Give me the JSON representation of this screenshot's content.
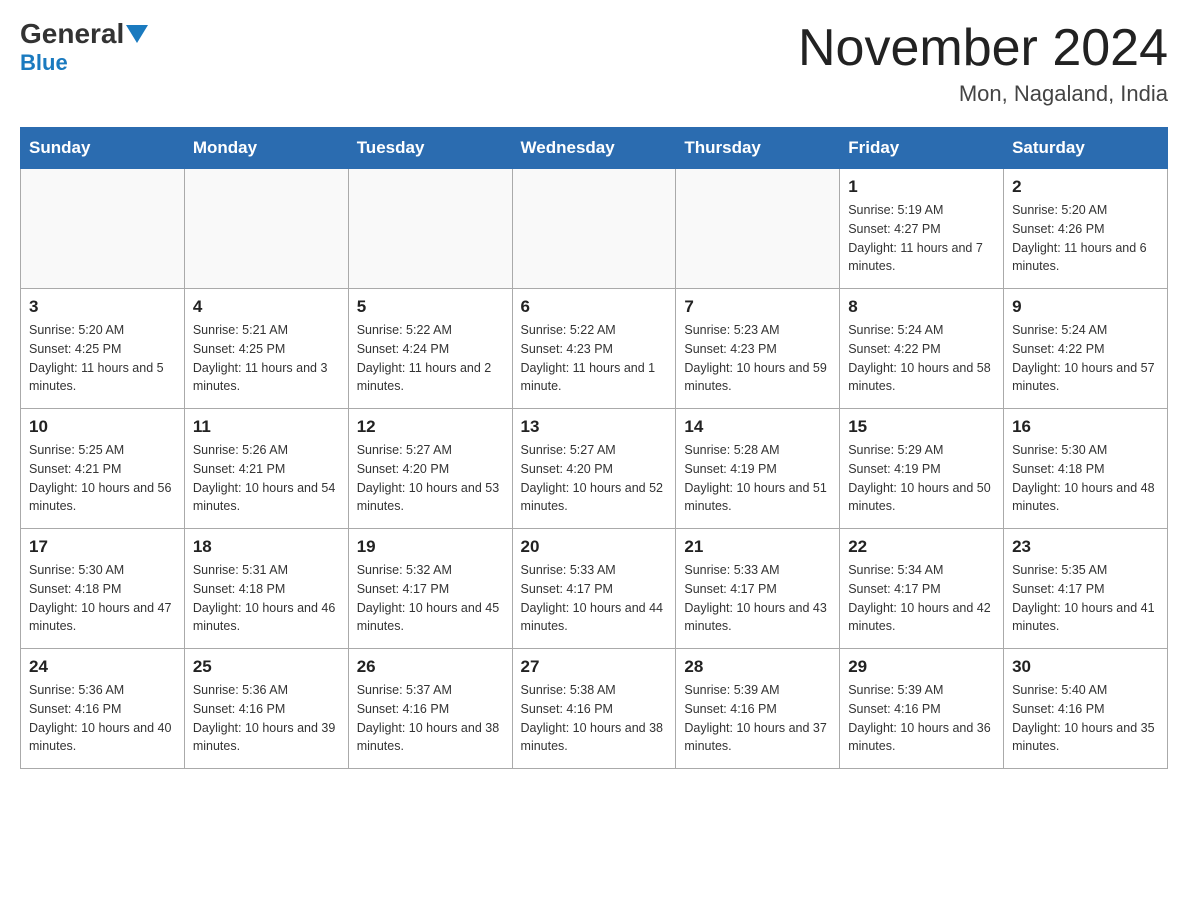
{
  "header": {
    "logo_main": "General",
    "logo_sub": "Blue",
    "month_title": "November 2024",
    "subtitle": "Mon, Nagaland, India"
  },
  "weekdays": [
    "Sunday",
    "Monday",
    "Tuesday",
    "Wednesday",
    "Thursday",
    "Friday",
    "Saturday"
  ],
  "weeks": [
    [
      {
        "day": "",
        "info": ""
      },
      {
        "day": "",
        "info": ""
      },
      {
        "day": "",
        "info": ""
      },
      {
        "day": "",
        "info": ""
      },
      {
        "day": "",
        "info": ""
      },
      {
        "day": "1",
        "info": "Sunrise: 5:19 AM\nSunset: 4:27 PM\nDaylight: 11 hours and 7 minutes."
      },
      {
        "day": "2",
        "info": "Sunrise: 5:20 AM\nSunset: 4:26 PM\nDaylight: 11 hours and 6 minutes."
      }
    ],
    [
      {
        "day": "3",
        "info": "Sunrise: 5:20 AM\nSunset: 4:25 PM\nDaylight: 11 hours and 5 minutes."
      },
      {
        "day": "4",
        "info": "Sunrise: 5:21 AM\nSunset: 4:25 PM\nDaylight: 11 hours and 3 minutes."
      },
      {
        "day": "5",
        "info": "Sunrise: 5:22 AM\nSunset: 4:24 PM\nDaylight: 11 hours and 2 minutes."
      },
      {
        "day": "6",
        "info": "Sunrise: 5:22 AM\nSunset: 4:23 PM\nDaylight: 11 hours and 1 minute."
      },
      {
        "day": "7",
        "info": "Sunrise: 5:23 AM\nSunset: 4:23 PM\nDaylight: 10 hours and 59 minutes."
      },
      {
        "day": "8",
        "info": "Sunrise: 5:24 AM\nSunset: 4:22 PM\nDaylight: 10 hours and 58 minutes."
      },
      {
        "day": "9",
        "info": "Sunrise: 5:24 AM\nSunset: 4:22 PM\nDaylight: 10 hours and 57 minutes."
      }
    ],
    [
      {
        "day": "10",
        "info": "Sunrise: 5:25 AM\nSunset: 4:21 PM\nDaylight: 10 hours and 56 minutes."
      },
      {
        "day": "11",
        "info": "Sunrise: 5:26 AM\nSunset: 4:21 PM\nDaylight: 10 hours and 54 minutes."
      },
      {
        "day": "12",
        "info": "Sunrise: 5:27 AM\nSunset: 4:20 PM\nDaylight: 10 hours and 53 minutes."
      },
      {
        "day": "13",
        "info": "Sunrise: 5:27 AM\nSunset: 4:20 PM\nDaylight: 10 hours and 52 minutes."
      },
      {
        "day": "14",
        "info": "Sunrise: 5:28 AM\nSunset: 4:19 PM\nDaylight: 10 hours and 51 minutes."
      },
      {
        "day": "15",
        "info": "Sunrise: 5:29 AM\nSunset: 4:19 PM\nDaylight: 10 hours and 50 minutes."
      },
      {
        "day": "16",
        "info": "Sunrise: 5:30 AM\nSunset: 4:18 PM\nDaylight: 10 hours and 48 minutes."
      }
    ],
    [
      {
        "day": "17",
        "info": "Sunrise: 5:30 AM\nSunset: 4:18 PM\nDaylight: 10 hours and 47 minutes."
      },
      {
        "day": "18",
        "info": "Sunrise: 5:31 AM\nSunset: 4:18 PM\nDaylight: 10 hours and 46 minutes."
      },
      {
        "day": "19",
        "info": "Sunrise: 5:32 AM\nSunset: 4:17 PM\nDaylight: 10 hours and 45 minutes."
      },
      {
        "day": "20",
        "info": "Sunrise: 5:33 AM\nSunset: 4:17 PM\nDaylight: 10 hours and 44 minutes."
      },
      {
        "day": "21",
        "info": "Sunrise: 5:33 AM\nSunset: 4:17 PM\nDaylight: 10 hours and 43 minutes."
      },
      {
        "day": "22",
        "info": "Sunrise: 5:34 AM\nSunset: 4:17 PM\nDaylight: 10 hours and 42 minutes."
      },
      {
        "day": "23",
        "info": "Sunrise: 5:35 AM\nSunset: 4:17 PM\nDaylight: 10 hours and 41 minutes."
      }
    ],
    [
      {
        "day": "24",
        "info": "Sunrise: 5:36 AM\nSunset: 4:16 PM\nDaylight: 10 hours and 40 minutes."
      },
      {
        "day": "25",
        "info": "Sunrise: 5:36 AM\nSunset: 4:16 PM\nDaylight: 10 hours and 39 minutes."
      },
      {
        "day": "26",
        "info": "Sunrise: 5:37 AM\nSunset: 4:16 PM\nDaylight: 10 hours and 38 minutes."
      },
      {
        "day": "27",
        "info": "Sunrise: 5:38 AM\nSunset: 4:16 PM\nDaylight: 10 hours and 38 minutes."
      },
      {
        "day": "28",
        "info": "Sunrise: 5:39 AM\nSunset: 4:16 PM\nDaylight: 10 hours and 37 minutes."
      },
      {
        "day": "29",
        "info": "Sunrise: 5:39 AM\nSunset: 4:16 PM\nDaylight: 10 hours and 36 minutes."
      },
      {
        "day": "30",
        "info": "Sunrise: 5:40 AM\nSunset: 4:16 PM\nDaylight: 10 hours and 35 minutes."
      }
    ]
  ]
}
